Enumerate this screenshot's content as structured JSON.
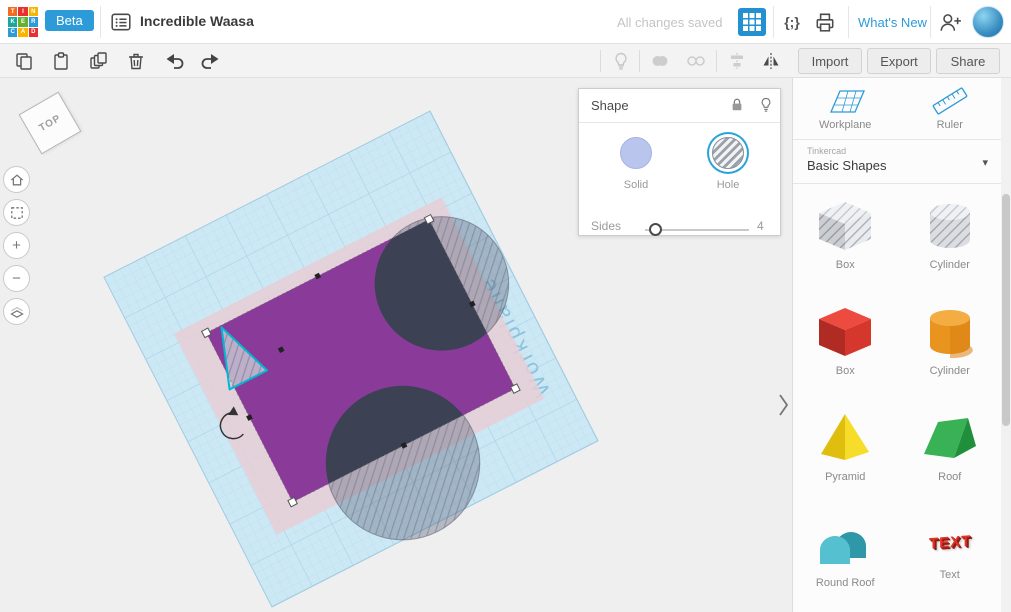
{
  "colors": {
    "accent_blue": "#2d9bd8",
    "shape_purple": "#8a3b9a",
    "hole_dark": "#3c4154",
    "workplane_blue": "#cde8f5",
    "selection_cyan": "#00b8d4"
  },
  "header": {
    "logo_tiles": [
      {
        "letter": "T",
        "color": "#f26c22"
      },
      {
        "letter": "I",
        "color": "#e8302e"
      },
      {
        "letter": "N",
        "color": "#f7b500"
      },
      {
        "letter": "K",
        "color": "#1aa89d"
      },
      {
        "letter": "E",
        "color": "#63b32e"
      },
      {
        "letter": "R",
        "color": "#2d9bd8"
      },
      {
        "letter": "C",
        "color": "#2d9bd8"
      },
      {
        "letter": "A",
        "color": "#f7b500"
      },
      {
        "letter": "D",
        "color": "#e8302e"
      }
    ],
    "beta_label": "Beta",
    "design_title": "Incredible Waasa",
    "save_status": "All changes saved",
    "whats_new_label": "What's New"
  },
  "icons": {
    "codeblocks_glyph": "{;}",
    "chevron_down_glyph": "▾",
    "zoom_in_glyph": "+",
    "zoom_out_glyph": "−"
  },
  "toolbar": {
    "import_label": "Import",
    "export_label": "Export",
    "share_label": "Share"
  },
  "viewcube": {
    "label": "TOP"
  },
  "shape_panel": {
    "title": "Shape",
    "solid_label": "Solid",
    "hole_label": "Hole",
    "selected_option": "Hole",
    "sides_label": "Sides",
    "sides_value": "4"
  },
  "canvas": {
    "workplane_text": "Workplane"
  },
  "sidebar": {
    "workplane_label": "Workplane",
    "ruler_label": "Ruler",
    "category_kicker": "Tinkercad",
    "category_label": "Basic Shapes",
    "text_glyph": "TEXT",
    "shapes": [
      {
        "label": "Box",
        "kind": "box-hole"
      },
      {
        "label": "Cylinder",
        "kind": "cylinder-hole"
      },
      {
        "label": "Box",
        "kind": "box-solid"
      },
      {
        "label": "Cylinder",
        "kind": "cylinder-solid"
      },
      {
        "label": "Pyramid",
        "kind": "pyramid"
      },
      {
        "label": "Roof",
        "kind": "roof"
      },
      {
        "label": "Round Roof",
        "kind": "round-roof"
      },
      {
        "label": "Text",
        "kind": "text"
      }
    ]
  }
}
